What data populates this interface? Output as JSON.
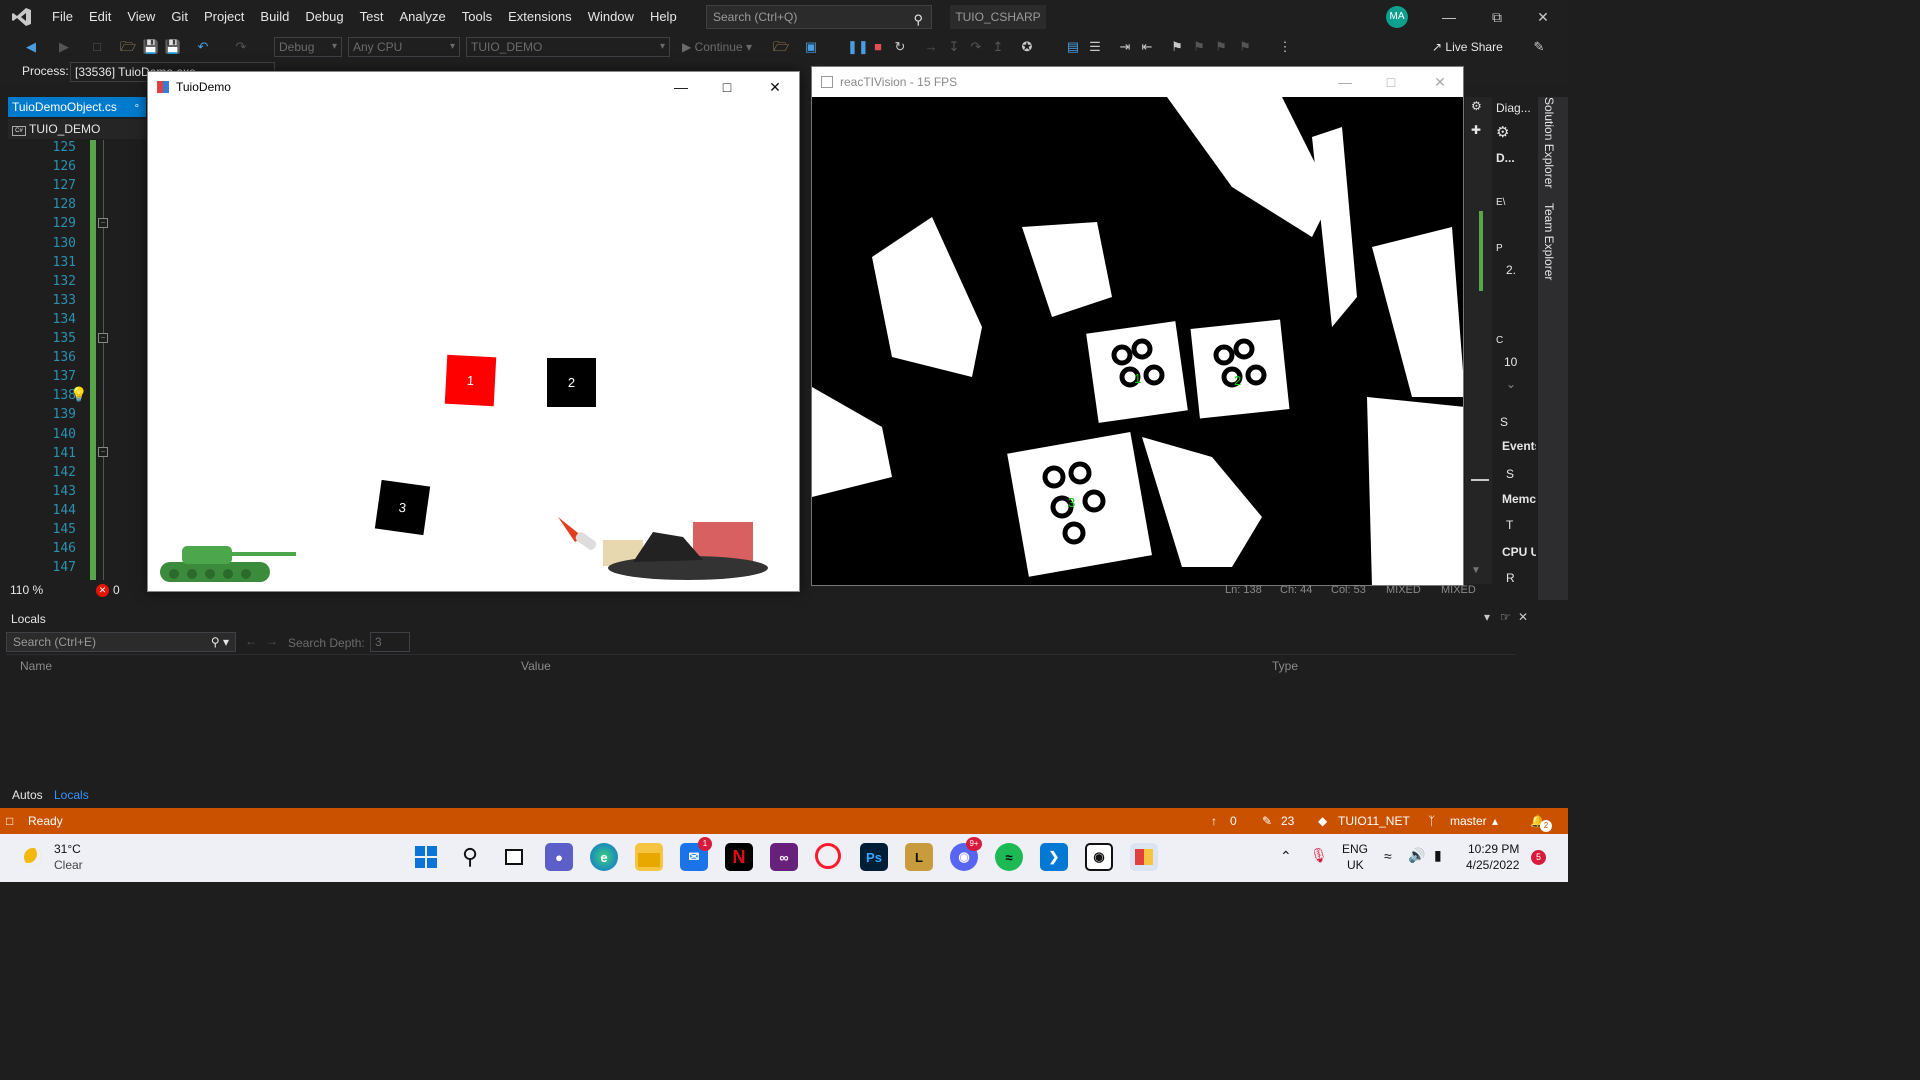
{
  "menu": [
    "File",
    "Edit",
    "View",
    "Git",
    "Project",
    "Build",
    "Debug",
    "Test",
    "Analyze",
    "Tools",
    "Extensions",
    "Window",
    "Help"
  ],
  "search": {
    "placeholder": "Search (Ctrl+Q)"
  },
  "solution_name": "TUIO_CSHARP",
  "user_initials": "MA",
  "toolbar": {
    "config": "Debug",
    "platform": "Any CPU",
    "startup_project": "TUIO_DEMO",
    "continue_label": "Continue",
    "live_share_label": "Live Share"
  },
  "debug_bar": {
    "process_label": "Process:",
    "process_value": "[33536] TuioDemo.exe"
  },
  "editor": {
    "tab_label": "TuioDemoObject.cs",
    "nav_project": "TUIO_DEMO",
    "line_numbers": [
      "125",
      "126",
      "127",
      "128",
      "129",
      "130",
      "131",
      "132",
      "133",
      "134",
      "135",
      "136",
      "137",
      "138",
      "139",
      "140",
      "141",
      "142",
      "143",
      "144",
      "145",
      "146",
      "147"
    ],
    "zoom": "110 %",
    "error_count": "0",
    "status": {
      "ln": "Ln: 138",
      "ch": "Ch: 44",
      "col": "Col: 53",
      "eol1": "MIXED",
      "eol2": "MIXED"
    }
  },
  "tuio_window": {
    "title": "TuioDemo",
    "objects": [
      {
        "label": "1",
        "color": "#ff0000"
      },
      {
        "label": "2",
        "color": "#000000"
      },
      {
        "label": "3",
        "color": "#000000"
      }
    ]
  },
  "reactivision_window": {
    "title": "reacTIVision - 15 FPS",
    "markers": [
      "1",
      "2",
      "3"
    ]
  },
  "diagnostic": {
    "title": "Diag...",
    "d_label": "D...",
    "events_label": "Events",
    "memory_label": "Memc",
    "cpu_label": "CPU U",
    "row_ev": "E\\",
    "row_p": "P",
    "row_2": "2.",
    "row_c": "C",
    "row_10": "10",
    "row_s": "S",
    "row_t": "T",
    "row_r": "R",
    "row_s2": "S"
  },
  "side_tabs": {
    "solution_explorer": "Solution Explorer",
    "team_explorer": "Team Explorer"
  },
  "locals": {
    "title": "Locals",
    "search_placeholder": "Search (Ctrl+E)",
    "search_depth_label": "Search Depth:",
    "search_depth_value": "3",
    "columns": {
      "name": "Name",
      "value": "Value",
      "type": "Type"
    },
    "tabs": {
      "autos": "Autos",
      "locals": "Locals"
    }
  },
  "statusbar": {
    "ready": "Ready",
    "up_count": "0",
    "pencil_count": "23",
    "repo": "TUIO11_NET",
    "branch": "master",
    "notif_count": "2"
  },
  "taskbar": {
    "temperature": "31°C",
    "condition": "Clear",
    "mail_badge": "1",
    "discord_badge": "9+",
    "language": "ENG",
    "region": "UK",
    "time": "10:29 PM",
    "date": "4/25/2022",
    "notification_count": "5"
  }
}
